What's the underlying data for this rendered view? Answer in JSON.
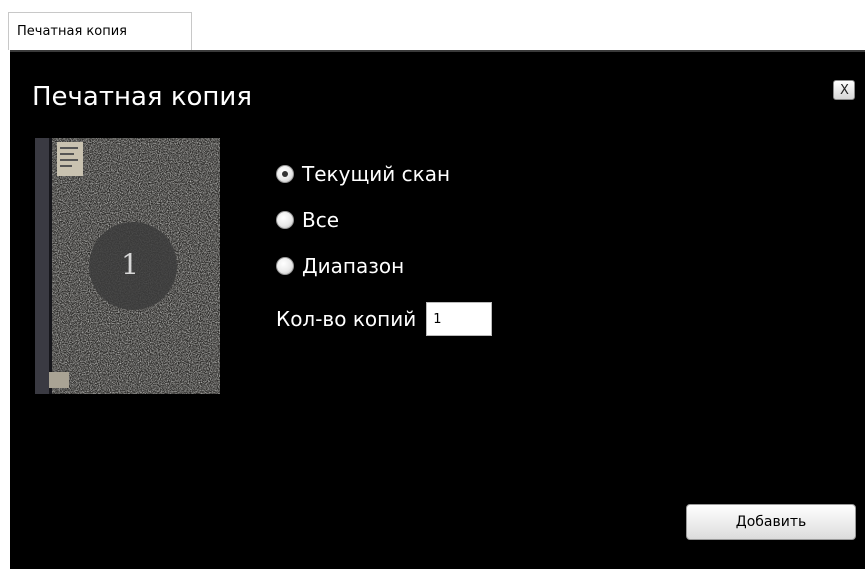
{
  "tab": {
    "label": "Печатная копия"
  },
  "dialog": {
    "title": "Печатная копия",
    "close_label": "X"
  },
  "thumbnail": {
    "page_number": "1"
  },
  "options": {
    "current_scan": "Текущий скан",
    "all": "Все",
    "range": "Диапазон",
    "selected": "current_scan"
  },
  "copies": {
    "label": "Кол-во копий",
    "value": "1"
  },
  "actions": {
    "add_label": "Добавить"
  },
  "colors": {
    "dialog_background": "#000000",
    "dialog_text": "#ffffff"
  }
}
